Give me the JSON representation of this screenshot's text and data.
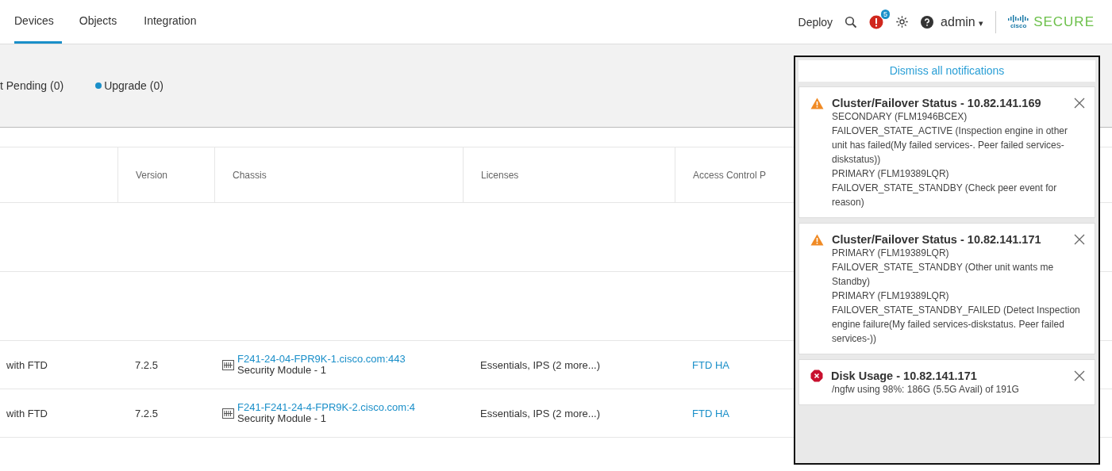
{
  "nav": {
    "tabs": [
      {
        "label": "Devices",
        "selected": true
      },
      {
        "label": "Objects",
        "selected": false
      },
      {
        "label": "Integration",
        "selected": false
      }
    ],
    "deploy": "Deploy",
    "alert_badge": "5",
    "user": "admin",
    "caret": "▾",
    "logo_small": "cisco",
    "logo_text": "SECURE"
  },
  "filters": [
    {
      "label": "t Pending (0)"
    },
    {
      "label": "Upgrade (0)",
      "color": "#1a8fc9"
    }
  ],
  "table": {
    "columns": [
      "Version",
      "Chassis",
      "Licenses",
      "Access Control P"
    ],
    "rows": [
      {
        "kind": "group"
      },
      {
        "kind": "group"
      },
      {
        "kind": "device",
        "model": "with FTD",
        "version": "7.2.5",
        "chassis": "F241-24-04-FPR9K-1.cisco.com:443",
        "module": "Security Module - 1",
        "licenses": "Essentials, IPS (2 more...)",
        "policy": "FTD HA"
      },
      {
        "kind": "device",
        "model": "with FTD",
        "version": "7.2.5",
        "chassis": "F241-F241-24-4-FPR9K-2.cisco.com:4",
        "module": "Security Module - 1",
        "licenses": "Essentials, IPS (2 more...)",
        "policy": "FTD HA"
      }
    ]
  },
  "notifications": {
    "dismiss": "Dismiss all notifications",
    "items": [
      {
        "kind": "warning",
        "title": "Cluster/Failover Status - 10.82.141.169",
        "lines": [
          "SECONDARY (FLM1946BCEX)",
          "FAILOVER_STATE_ACTIVE (Inspection engine in other unit has failed(My failed services-. Peer failed services-diskstatus))",
          "PRIMARY (FLM19389LQR)",
          "FAILOVER_STATE_STANDBY (Check peer event for reason)"
        ]
      },
      {
        "kind": "warning",
        "title": "Cluster/Failover Status - 10.82.141.171",
        "lines": [
          "PRIMARY (FLM19389LQR)",
          "FAILOVER_STATE_STANDBY (Other unit wants me Standby)",
          "PRIMARY (FLM19389LQR)",
          "FAILOVER_STATE_STANDBY_FAILED (Detect Inspection engine failure(My failed services-diskstatus. Peer failed services-))"
        ]
      },
      {
        "kind": "error",
        "title": "Disk Usage - 10.82.141.171",
        "lines": [
          "/ngfw using 98%: 186G (5.5G Avail) of 191G"
        ]
      }
    ]
  }
}
